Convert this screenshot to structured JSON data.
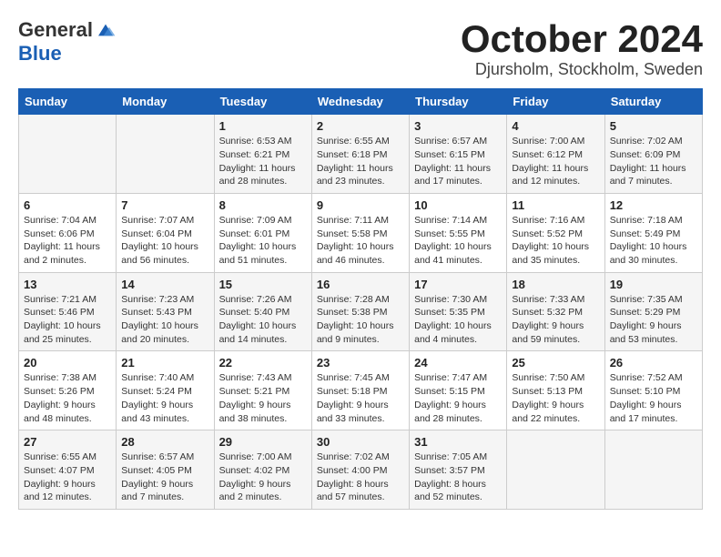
{
  "logo": {
    "general": "General",
    "blue": "Blue"
  },
  "title": {
    "month": "October 2024",
    "location": "Djursholm, Stockholm, Sweden"
  },
  "weekdays": [
    "Sunday",
    "Monday",
    "Tuesday",
    "Wednesday",
    "Thursday",
    "Friday",
    "Saturday"
  ],
  "weeks": [
    [
      {
        "day": "",
        "info": ""
      },
      {
        "day": "",
        "info": ""
      },
      {
        "day": "1",
        "info": "Sunrise: 6:53 AM\nSunset: 6:21 PM\nDaylight: 11 hours\nand 28 minutes."
      },
      {
        "day": "2",
        "info": "Sunrise: 6:55 AM\nSunset: 6:18 PM\nDaylight: 11 hours\nand 23 minutes."
      },
      {
        "day": "3",
        "info": "Sunrise: 6:57 AM\nSunset: 6:15 PM\nDaylight: 11 hours\nand 17 minutes."
      },
      {
        "day": "4",
        "info": "Sunrise: 7:00 AM\nSunset: 6:12 PM\nDaylight: 11 hours\nand 12 minutes."
      },
      {
        "day": "5",
        "info": "Sunrise: 7:02 AM\nSunset: 6:09 PM\nDaylight: 11 hours\nand 7 minutes."
      }
    ],
    [
      {
        "day": "6",
        "info": "Sunrise: 7:04 AM\nSunset: 6:06 PM\nDaylight: 11 hours\nand 2 minutes."
      },
      {
        "day": "7",
        "info": "Sunrise: 7:07 AM\nSunset: 6:04 PM\nDaylight: 10 hours\nand 56 minutes."
      },
      {
        "day": "8",
        "info": "Sunrise: 7:09 AM\nSunset: 6:01 PM\nDaylight: 10 hours\nand 51 minutes."
      },
      {
        "day": "9",
        "info": "Sunrise: 7:11 AM\nSunset: 5:58 PM\nDaylight: 10 hours\nand 46 minutes."
      },
      {
        "day": "10",
        "info": "Sunrise: 7:14 AM\nSunset: 5:55 PM\nDaylight: 10 hours\nand 41 minutes."
      },
      {
        "day": "11",
        "info": "Sunrise: 7:16 AM\nSunset: 5:52 PM\nDaylight: 10 hours\nand 35 minutes."
      },
      {
        "day": "12",
        "info": "Sunrise: 7:18 AM\nSunset: 5:49 PM\nDaylight: 10 hours\nand 30 minutes."
      }
    ],
    [
      {
        "day": "13",
        "info": "Sunrise: 7:21 AM\nSunset: 5:46 PM\nDaylight: 10 hours\nand 25 minutes."
      },
      {
        "day": "14",
        "info": "Sunrise: 7:23 AM\nSunset: 5:43 PM\nDaylight: 10 hours\nand 20 minutes."
      },
      {
        "day": "15",
        "info": "Sunrise: 7:26 AM\nSunset: 5:40 PM\nDaylight: 10 hours\nand 14 minutes."
      },
      {
        "day": "16",
        "info": "Sunrise: 7:28 AM\nSunset: 5:38 PM\nDaylight: 10 hours\nand 9 minutes."
      },
      {
        "day": "17",
        "info": "Sunrise: 7:30 AM\nSunset: 5:35 PM\nDaylight: 10 hours\nand 4 minutes."
      },
      {
        "day": "18",
        "info": "Sunrise: 7:33 AM\nSunset: 5:32 PM\nDaylight: 9 hours\nand 59 minutes."
      },
      {
        "day": "19",
        "info": "Sunrise: 7:35 AM\nSunset: 5:29 PM\nDaylight: 9 hours\nand 53 minutes."
      }
    ],
    [
      {
        "day": "20",
        "info": "Sunrise: 7:38 AM\nSunset: 5:26 PM\nDaylight: 9 hours\nand 48 minutes."
      },
      {
        "day": "21",
        "info": "Sunrise: 7:40 AM\nSunset: 5:24 PM\nDaylight: 9 hours\nand 43 minutes."
      },
      {
        "day": "22",
        "info": "Sunrise: 7:43 AM\nSunset: 5:21 PM\nDaylight: 9 hours\nand 38 minutes."
      },
      {
        "day": "23",
        "info": "Sunrise: 7:45 AM\nSunset: 5:18 PM\nDaylight: 9 hours\nand 33 minutes."
      },
      {
        "day": "24",
        "info": "Sunrise: 7:47 AM\nSunset: 5:15 PM\nDaylight: 9 hours\nand 28 minutes."
      },
      {
        "day": "25",
        "info": "Sunrise: 7:50 AM\nSunset: 5:13 PM\nDaylight: 9 hours\nand 22 minutes."
      },
      {
        "day": "26",
        "info": "Sunrise: 7:52 AM\nSunset: 5:10 PM\nDaylight: 9 hours\nand 17 minutes."
      }
    ],
    [
      {
        "day": "27",
        "info": "Sunrise: 6:55 AM\nSunset: 4:07 PM\nDaylight: 9 hours\nand 12 minutes."
      },
      {
        "day": "28",
        "info": "Sunrise: 6:57 AM\nSunset: 4:05 PM\nDaylight: 9 hours\nand 7 minutes."
      },
      {
        "day": "29",
        "info": "Sunrise: 7:00 AM\nSunset: 4:02 PM\nDaylight: 9 hours\nand 2 minutes."
      },
      {
        "day": "30",
        "info": "Sunrise: 7:02 AM\nSunset: 4:00 PM\nDaylight: 8 hours\nand 57 minutes."
      },
      {
        "day": "31",
        "info": "Sunrise: 7:05 AM\nSunset: 3:57 PM\nDaylight: 8 hours\nand 52 minutes."
      },
      {
        "day": "",
        "info": ""
      },
      {
        "day": "",
        "info": ""
      }
    ]
  ]
}
